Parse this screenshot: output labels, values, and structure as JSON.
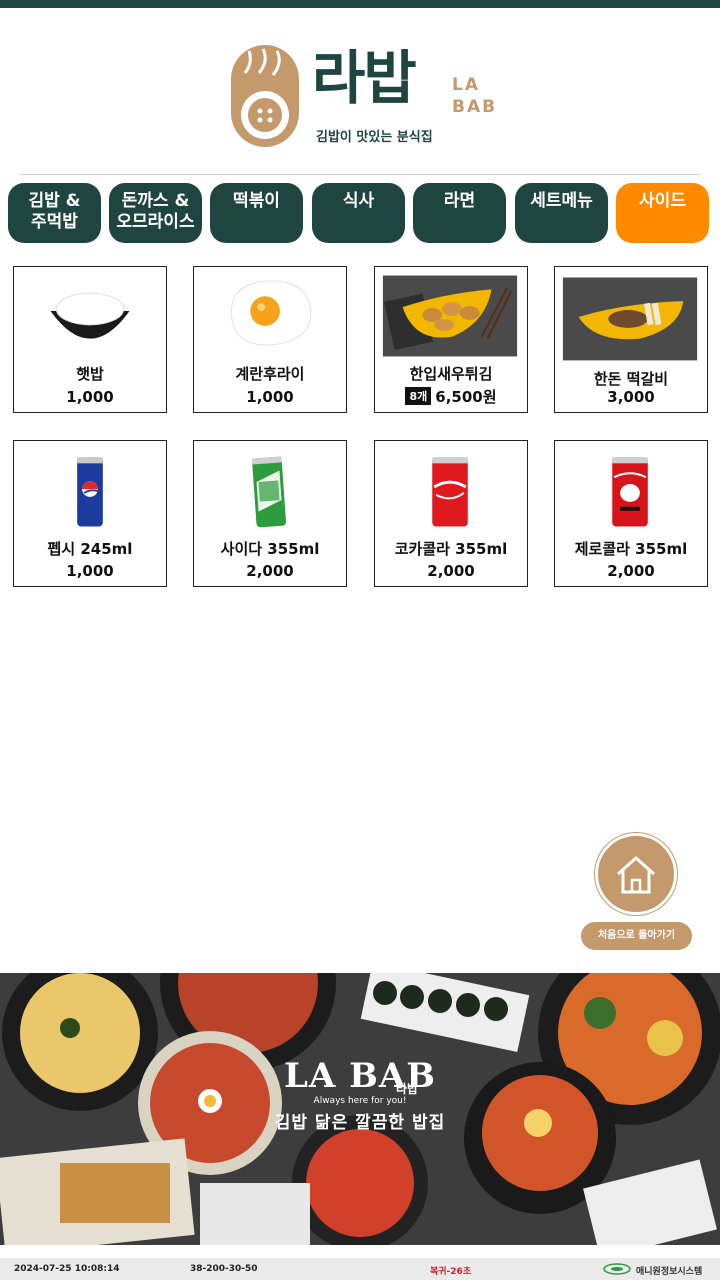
{
  "brand": {
    "title_kr": "라밥",
    "title_en_line1": "LA",
    "title_en_line2": "BAB",
    "tagline": "김밥이 맛있는 분식집"
  },
  "tabs": [
    {
      "line1": "김밥 &",
      "line2": "주먹밥",
      "active": false
    },
    {
      "line1": "돈까스 &",
      "line2": "오므라이스",
      "active": false
    },
    {
      "line1": "떡볶이",
      "line2": "",
      "active": false
    },
    {
      "line1": "식사",
      "line2": "",
      "active": false
    },
    {
      "line1": "라면",
      "line2": "",
      "active": false
    },
    {
      "line1": "세트메뉴",
      "line2": "",
      "active": false
    },
    {
      "line1": "사이드",
      "line2": "",
      "active": true
    }
  ],
  "products": [
    {
      "name": "햇밥",
      "price": "1,000",
      "image": "rice-bowl"
    },
    {
      "name": "계란후라이",
      "price": "1,000",
      "image": "fried-egg"
    },
    {
      "name": "한입새우튀김",
      "badge": "8개",
      "price": "6,500원",
      "image": "shrimp-tempura"
    },
    {
      "name": "한돈 떡갈비",
      "price": "3,000",
      "image": "tteokgalbi"
    },
    {
      "name": "펩시 245ml",
      "price": "1,000",
      "image": "pepsi-can"
    },
    {
      "name": "사이다 355ml",
      "price": "2,000",
      "image": "cider-can"
    },
    {
      "name": "코카콜라 355ml",
      "price": "2,000",
      "image": "coke-can"
    },
    {
      "name": "제로콜라 355ml",
      "price": "2,000",
      "image": "zero-coke-can"
    }
  ],
  "home": {
    "label": "처음으로 돌아가기",
    "icon": "home-icon"
  },
  "banner": {
    "logo": "LA BAB",
    "logo_kr": "라밥",
    "small": "Always here for you!",
    "slogan": "김밥 닮은 깔끔한 밥집"
  },
  "status": {
    "datetime": "2024-07-25 10:08:14",
    "code": "38-200-30-50",
    "queue": "복귀-26초",
    "company": "애니원정보시스템"
  },
  "colors": {
    "brand_green": "#1f4540",
    "active_orange": "#ff8a00",
    "accent_tan": "#c49a6c"
  }
}
